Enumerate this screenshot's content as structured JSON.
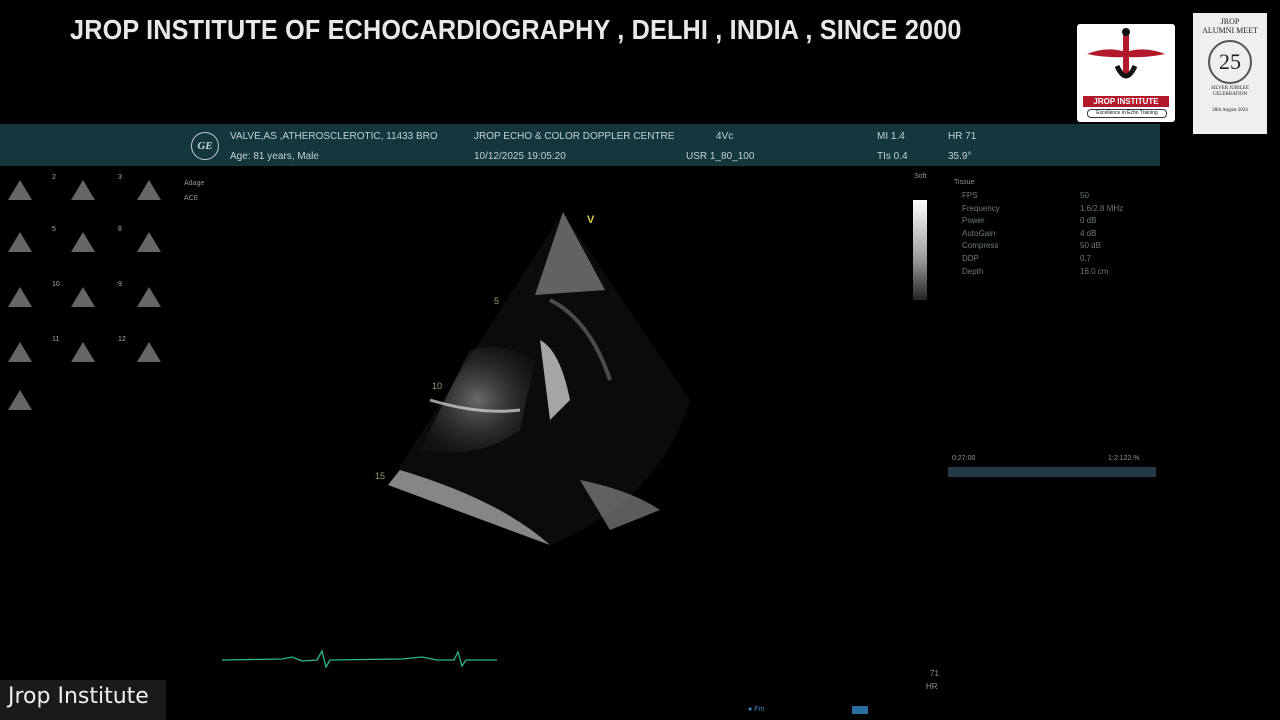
{
  "banner": {
    "title": "JROP INSTITUTE OF ECHOCARDIOGRAPHY , DELHI , INDIA , SINCE 2000"
  },
  "logo": {
    "caption": "JROP INSTITUTE",
    "tagline": "Excellence in Echo Training"
  },
  "alumni_meet": {
    "line1": "JROP",
    "line2": "ALUMNI MEET",
    "number": "25",
    "sub1": "SILVER JUBILEE",
    "sub2": "CELEBRATION",
    "date": "28th August 2024"
  },
  "scan_header": {
    "patient_line": "VALVE,AS ,ATHEROSCLEROTIC, 11433 BRO",
    "centre": "JROP  ECHO & COLOR DOPPLER CENTRE",
    "view": "4Vc",
    "mi": "MI 1.4",
    "hr": "HR 71",
    "age_line": "Age: 81 years, Male",
    "datetime": "10/12/2025 19:05:20",
    "usr": "USR  1_80_100",
    "tis": "TIs 0.4",
    "angle": "35.9°"
  },
  "left_panel": {
    "label1": "Adage",
    "label2": "ACE"
  },
  "thumbnails": [
    "2",
    "3",
    "5",
    "8",
    "10",
    "9",
    "11",
    "12"
  ],
  "scale_label": "Soft",
  "params": {
    "section": "Tissue",
    "labels": [
      "FPS",
      "Frequency",
      "Power",
      "AutoGain",
      "Compress",
      "DDP",
      "Depth"
    ],
    "values": [
      "50",
      "1.6/2.8 MHz",
      "0 dB",
      "4 dB",
      "50 dB",
      "0.7",
      "16.0 cm"
    ]
  },
  "timeline": {
    "left": "0:27:00",
    "right": "1:2:122.%"
  },
  "depth_marks": [
    "5",
    "10",
    "15"
  ],
  "sector_marker": "V",
  "hr_bottom": {
    "value": "71",
    "label": "HR"
  },
  "footer": {
    "label": "Jrop Institute"
  },
  "bottom_controls": {
    "text": "Fm"
  }
}
